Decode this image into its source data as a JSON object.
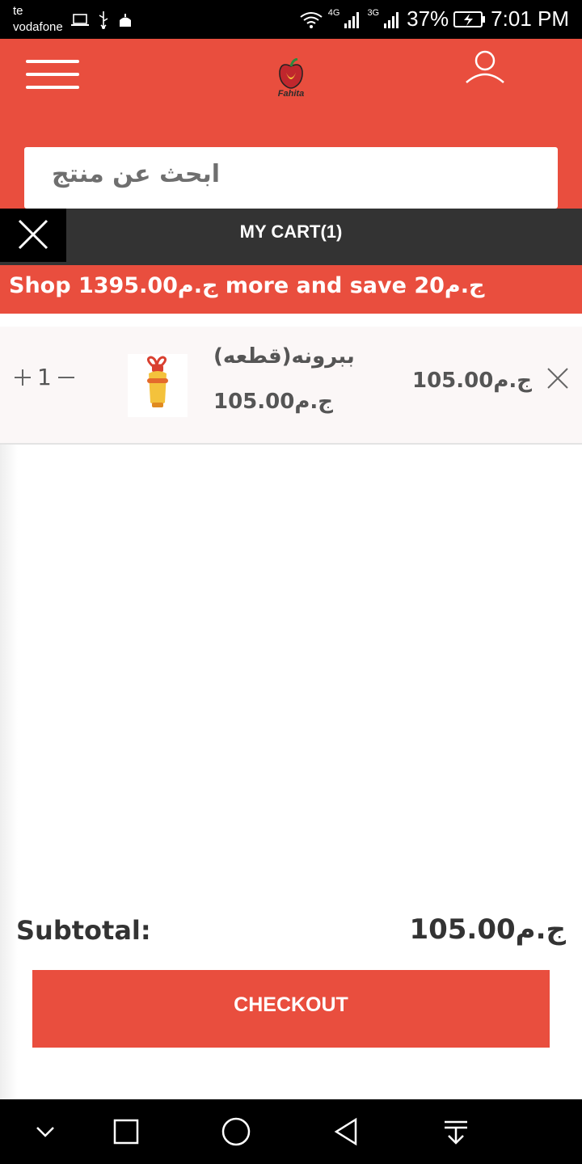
{
  "status_bar": {
    "carrier_line1": "te",
    "carrier_line2": "vodafone",
    "network_left": "4G",
    "network_right": "3G",
    "battery": "37%",
    "time": "7:01 PM"
  },
  "header": {
    "logo_text": "Fahita",
    "search_placeholder": "ابحث عن منتج"
  },
  "cart": {
    "title": "MY CART(1)",
    "promo": "Shop 1395.00ج.م more and save 20ج.م"
  },
  "items": [
    {
      "name": "ببرونه(قطعه)",
      "unit_price": "105.00ج.م",
      "quantity": "1",
      "total": "105.00ج.م"
    }
  ],
  "summary": {
    "subtotal_label": "Subtotal:",
    "subtotal_value": "105.00ج.م",
    "checkout_label": "CHECKOUT"
  },
  "colors": {
    "brand": "#e94e3e",
    "dark_bar": "#333333"
  }
}
